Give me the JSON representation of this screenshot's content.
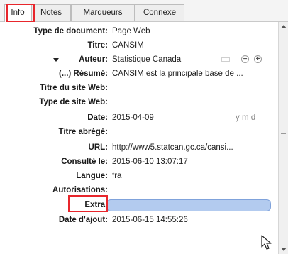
{
  "tabs": [
    {
      "label": "Info",
      "active": true
    },
    {
      "label": "Notes",
      "active": false
    },
    {
      "label": "Marqueurs",
      "active": false
    },
    {
      "label": "Connexe",
      "active": false
    }
  ],
  "fields": {
    "item_type": {
      "label": "Type de document:",
      "value": "Page Web"
    },
    "title": {
      "label": "Titre:",
      "value": "CANSIM"
    },
    "creator": {
      "label": "Auteur:",
      "value": "Statistique Canada"
    },
    "abstract": {
      "label": "(...) Résumé:",
      "value": "CANSIM est la principale base de ..."
    },
    "website_title": {
      "label": "Titre du site Web:",
      "value": ""
    },
    "website_type": {
      "label": "Type de site Web:",
      "value": ""
    },
    "date": {
      "label": "Date:",
      "value": "2015-04-09",
      "format": "y m d"
    },
    "short_title": {
      "label": "Titre abrégé:",
      "value": ""
    },
    "url": {
      "label": "URL:",
      "value": "http://www5.statcan.gc.ca/cansi..."
    },
    "accessed": {
      "label": "Consulté le:",
      "value": "2015-06-10 13:07:17"
    },
    "language": {
      "label": "Langue:",
      "value": "fra"
    },
    "rights": {
      "label": "Autorisations:",
      "value": ""
    },
    "extra": {
      "label": "Extra:",
      "value": ""
    },
    "date_added": {
      "label": "Date d'ajout:",
      "value": "2015-06-15 14:55:26"
    }
  },
  "colors": {
    "highlight": "#e8262c",
    "active_input": "#b3cbef"
  },
  "icons": [
    "creator-type-icon",
    "minus-icon",
    "plus-icon",
    "collapse-triangle-icon",
    "mouse-cursor-icon"
  ]
}
